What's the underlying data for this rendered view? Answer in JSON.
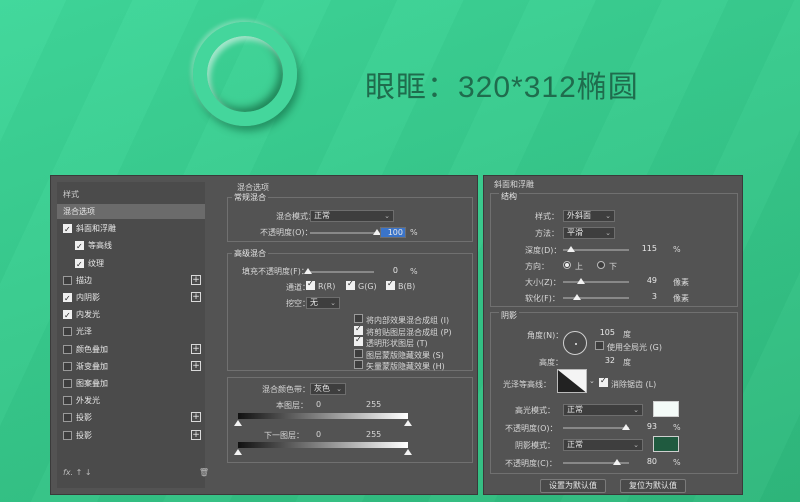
{
  "headline": "眼眶：320*312椭圆",
  "styles": {
    "title": "样式",
    "items": [
      {
        "label": "混合选项",
        "cb": null,
        "plus": false,
        "selected": true
      },
      {
        "label": "斜面和浮雕",
        "cb": true,
        "plus": false
      },
      {
        "label": "等高线",
        "cb": true,
        "plus": false,
        "indent": true
      },
      {
        "label": "纹理",
        "cb": true,
        "plus": false,
        "indent": true
      },
      {
        "label": "描边",
        "cb": false,
        "plus": true
      },
      {
        "label": "内阴影",
        "cb": true,
        "plus": true
      },
      {
        "label": "内发光",
        "cb": true,
        "plus": false
      },
      {
        "label": "光泽",
        "cb": false,
        "plus": false
      },
      {
        "label": "颜色叠加",
        "cb": false,
        "plus": true
      },
      {
        "label": "渐变叠加",
        "cb": false,
        "plus": true
      },
      {
        "label": "图案叠加",
        "cb": false,
        "plus": false
      },
      {
        "label": "外发光",
        "cb": false,
        "plus": false
      },
      {
        "label": "投影",
        "cb": false,
        "plus": true
      },
      {
        "label": "投影",
        "cb": false,
        "plus": true
      }
    ],
    "footer": "fx. ↑ ↓"
  },
  "blend": {
    "title": "混合选项",
    "general": {
      "title": "常规混合",
      "mode_label": "混合模式：",
      "mode_value": "正常",
      "opacity_label": "不透明度(O)：",
      "opacity_value": "100",
      "opacity_unit": "%"
    },
    "advanced": {
      "title": "高级混合",
      "fill_label": "填充不透明度(F)：",
      "fill_value": "0",
      "fill_unit": "%",
      "channels_label": "通道：",
      "channel_r": "R(R)",
      "channel_g": "G(G)",
      "channel_b": "B(B)",
      "knockout_label": "挖空：",
      "knockout_value": "无",
      "options": [
        {
          "label": "将内部效果混合成组 (I)",
          "checked": false
        },
        {
          "label": "将剪贴图层混合成组 (P)",
          "checked": true
        },
        {
          "label": "透明形状图层 (T)",
          "checked": true
        },
        {
          "label": "图层蒙版隐藏效果 (S)",
          "checked": false
        },
        {
          "label": "矢量蒙版隐藏效果 (H)",
          "checked": false
        }
      ]
    },
    "blend_if": {
      "label": "混合颜色带：",
      "value": "灰色",
      "this_layer": "本图层：",
      "this_min": "0",
      "this_max": "255",
      "under_layer": "下一图层：",
      "under_min": "0",
      "under_max": "255"
    }
  },
  "bevel": {
    "title": "斜面和浮雕",
    "structure": {
      "title": "结构",
      "style_label": "样式：",
      "style_value": "外斜面",
      "technique_label": "方法：",
      "technique_value": "平滑",
      "depth_label": "深度(D)：",
      "depth_value": "115",
      "depth_unit": "%",
      "direction_label": "方向：",
      "dir_up": "上",
      "dir_down": "下",
      "size_label": "大小(Z)：",
      "size_value": "49",
      "size_unit": "像素",
      "soften_label": "软化(F)：",
      "soften_value": "3",
      "soften_unit": "像素"
    },
    "shading": {
      "title": "阴影",
      "angle_label": "角度(N)：",
      "angle_value": "105",
      "angle_unit": "度",
      "global_light": "使用全局光 (G)",
      "altitude_label": "高度：",
      "altitude_value": "32",
      "altitude_unit": "度",
      "gloss_label": "光泽等高线：",
      "antialias": "消除锯齿 (L)",
      "highlight_label": "高光模式：",
      "highlight_value": "正常",
      "highlight_color": "#f4fbf8",
      "hl_opacity_label": "不透明度(O)：",
      "hl_opacity_value": "93",
      "hl_opacity_unit": "%",
      "shadow_label": "阴影模式：",
      "shadow_value": "正常",
      "shadow_color": "#1f5a3f",
      "sh_opacity_label": "不透明度(C)：",
      "sh_opacity_value": "80",
      "sh_opacity_unit": "%"
    },
    "make_default": "设置为默认值",
    "reset_default": "复位为默认值"
  }
}
